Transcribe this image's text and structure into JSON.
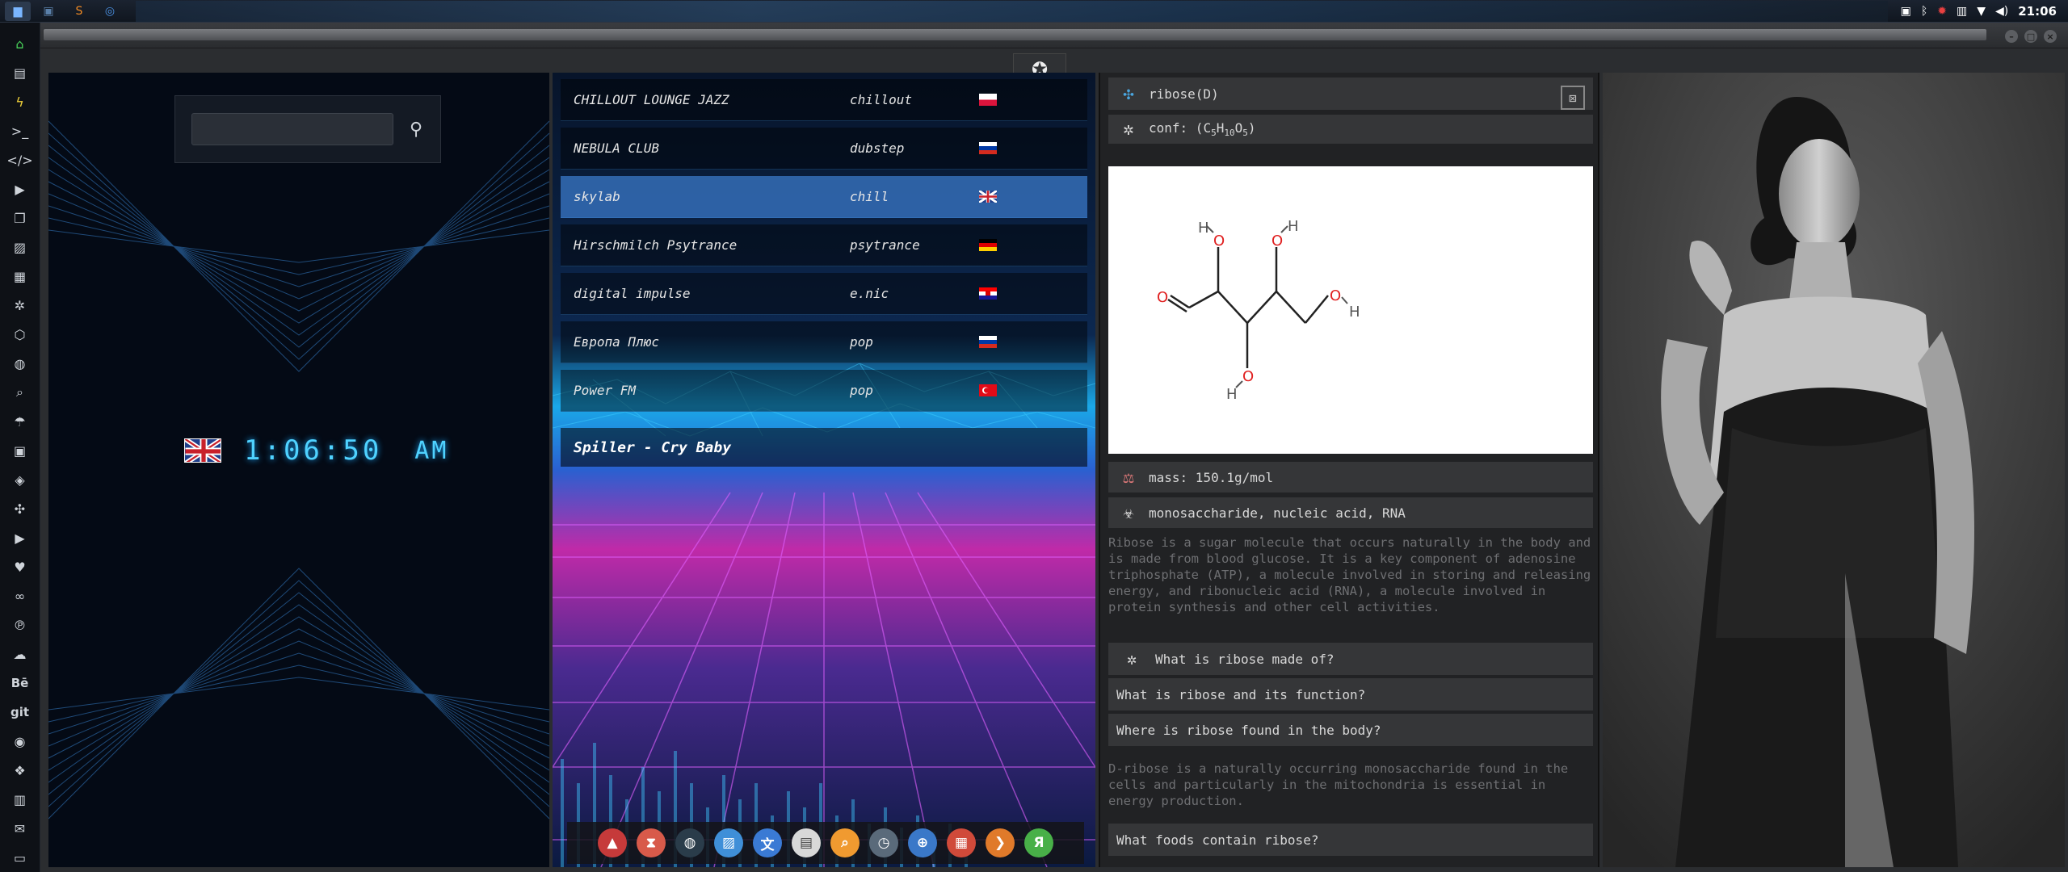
{
  "topbar": {
    "apps": [
      {
        "icon": "folder-icon"
      },
      {
        "icon": "terminal-icon"
      },
      {
        "icon": "sublime-icon"
      },
      {
        "icon": "chrome-icon"
      }
    ],
    "clock": "21:06"
  },
  "sidebar": {
    "items": [
      {
        "icon": "home-icon"
      },
      {
        "icon": "document-icon"
      },
      {
        "icon": "bolt-icon"
      },
      {
        "icon": "terminal-prompt-icon"
      },
      {
        "icon": "code-icon"
      },
      {
        "icon": "play-icon"
      },
      {
        "icon": "files-icon"
      },
      {
        "icon": "image-icon"
      },
      {
        "icon": "news-icon"
      },
      {
        "icon": "atom-icon"
      },
      {
        "icon": "hexagon-icon"
      },
      {
        "icon": "globe-icon"
      },
      {
        "icon": "search-icon"
      },
      {
        "icon": "umbrella-icon"
      },
      {
        "icon": "id-card-icon"
      },
      {
        "icon": "tag-icon"
      },
      {
        "icon": "molecule-icon"
      },
      {
        "icon": "youtube-icon"
      },
      {
        "icon": "heart-icon"
      },
      {
        "icon": "lastfm-icon"
      },
      {
        "icon": "pinterest-icon"
      },
      {
        "icon": "cloud-icon"
      },
      {
        "icon": "behance-icon",
        "label": "Bē"
      },
      {
        "icon": "git-icon",
        "label": "git"
      },
      {
        "icon": "github-icon"
      },
      {
        "icon": "boxes-icon"
      },
      {
        "icon": "map-icon"
      },
      {
        "icon": "mail-icon"
      },
      {
        "icon": "desktop-icon"
      }
    ]
  },
  "clock_widget": {
    "time": "1:06:50",
    "ampm": "AM",
    "flag": "uk-flag"
  },
  "radio": {
    "stations": [
      {
        "name": "CHILLOUT LOUNGE JAZZ",
        "genre": "chillout",
        "flag": "poland-flag"
      },
      {
        "name": "NEBULA CLUB",
        "genre": "dubstep",
        "flag": "russia-flag"
      },
      {
        "name": "skylab",
        "genre": "chill",
        "flag": "uk-flag"
      },
      {
        "name": "Hirschmilch Psytrance",
        "genre": "psytrance",
        "flag": "germany-flag"
      },
      {
        "name": "digital impulse",
        "genre": "e.nic",
        "flag": "croatia-flag"
      },
      {
        "name": "Европа Плюс",
        "genre": "pop",
        "flag": "russia-flag"
      },
      {
        "name": "Power FM",
        "genre": "pop",
        "flag": "turkey-flag"
      }
    ],
    "now_playing": "Spiller - Cry Baby",
    "dock": [
      {
        "icon": "triangle-app-icon",
        "color": "#c63a3a"
      },
      {
        "icon": "hourglass-icon",
        "color": "#d85a4a"
      },
      {
        "icon": "globe-dark-icon",
        "color": "#2a3c4a"
      },
      {
        "icon": "photos-icon",
        "color": "#3f8fd8"
      },
      {
        "icon": "translate-icon",
        "color": "#3a7ad4"
      },
      {
        "icon": "news-app-icon",
        "color": "#d8d8d8"
      },
      {
        "icon": "search-app-icon",
        "color": "#f09a30"
      },
      {
        "icon": "clock-app-icon",
        "color": "#5a6a7a"
      },
      {
        "icon": "web-icon",
        "color": "#3a78c8"
      },
      {
        "icon": "calendar-icon",
        "color": "#d04a3a"
      },
      {
        "icon": "arrow-app-icon",
        "color": "#e07a2a"
      },
      {
        "icon": "yandex-icon",
        "color": "#48b048",
        "label": "Я"
      }
    ]
  },
  "chem": {
    "name": "ribose(D)",
    "conf_prefix": "conf: (",
    "formula_c": "C",
    "formula_c_n": "5",
    "formula_h": "H",
    "formula_h_n": "10",
    "formula_o": "O",
    "formula_o_n": "5",
    "conf_suffix": ")",
    "mass": "mass: 150.1g/mol",
    "categories": "monosaccharide, nucleic acid, RNA",
    "description": "Ribose is a sugar molecule that occurs naturally in the body and is made from blood glucose. It is a key component of adenosine triphosphate (ATP), a molecule involved in storing and releasing energy, and ribonucleic acid (RNA), a molecule involved in protein synthesis and other cell activities.",
    "questions": [
      "What is ribose made of?",
      "What is ribose and its function?",
      "Where is ribose found in the body?"
    ],
    "answer": "D-ribose is a naturally occurring monosaccharide found in the cells and particularly in the mitochondria is essential in energy production.",
    "last_question": "What foods contain ribose?",
    "molecule_labels": {
      "o": "O",
      "h": "H"
    },
    "colors": {
      "oxygen": "#e02020",
      "bond": "#222222",
      "hydrogen": "#555555"
    }
  }
}
